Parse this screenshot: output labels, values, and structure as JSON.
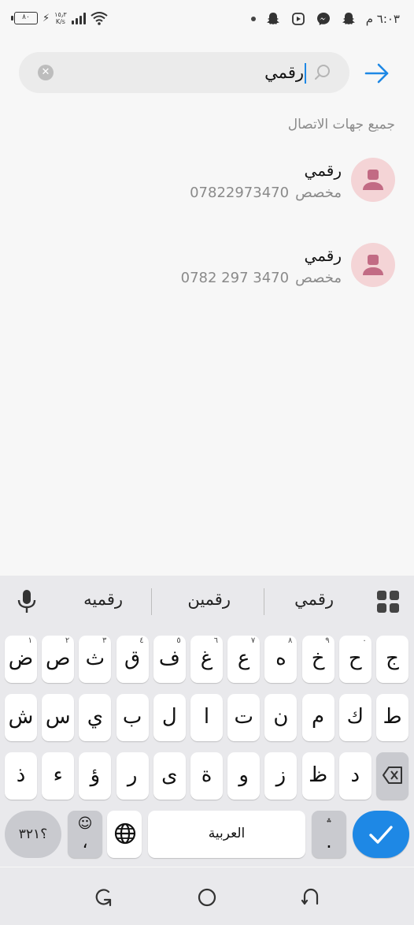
{
  "status_bar": {
    "time": "٦:٠٣ م",
    "battery": "٨٠",
    "net_speed_value": "١٥٫٣",
    "net_speed_unit": "K/s"
  },
  "search": {
    "query": "رقمي",
    "clear_icon": "clear-icon",
    "search_icon": "search-icon",
    "go_icon": "arrow-right-icon"
  },
  "section_label": "جميع جهات الاتصال",
  "contacts": [
    {
      "name": "رقمي",
      "type_label": "مخصص",
      "number": "07822973470"
    },
    {
      "name": "رقمي",
      "type_label": "مخصص",
      "number": "0782 297 3470"
    }
  ],
  "keyboard": {
    "suggestions": [
      "رقمي",
      "رقمين",
      "رقميه"
    ],
    "row1": [
      {
        "k": "ض",
        "h": "١"
      },
      {
        "k": "ص",
        "h": "٢"
      },
      {
        "k": "ث",
        "h": "٣"
      },
      {
        "k": "ق",
        "h": "٤"
      },
      {
        "k": "ف",
        "h": "٥"
      },
      {
        "k": "غ",
        "h": "٦"
      },
      {
        "k": "ع",
        "h": "٧"
      },
      {
        "k": "ه",
        "h": "٨"
      },
      {
        "k": "خ",
        "h": "٩"
      },
      {
        "k": "ح",
        "h": "٠"
      },
      {
        "k": "ج",
        "h": ""
      }
    ],
    "row2": [
      "ش",
      "س",
      "ي",
      "ب",
      "ل",
      "ا",
      "ت",
      "ن",
      "م",
      "ك",
      "ط"
    ],
    "row3": [
      "ذ",
      "ء",
      "ؤ",
      "ر",
      "ى",
      "ة",
      "و",
      "ز",
      "ظ",
      "د"
    ],
    "num_key": "؟٣٢١",
    "space_label": "العربية",
    "emoji_hint": "☺",
    "comma_key": "،",
    "period_key": ".",
    "period_hint": "؞"
  },
  "accent_color": "#1e88e5",
  "avatar_color": "#f4d4d6",
  "avatar_icon_color": "#c26b84"
}
